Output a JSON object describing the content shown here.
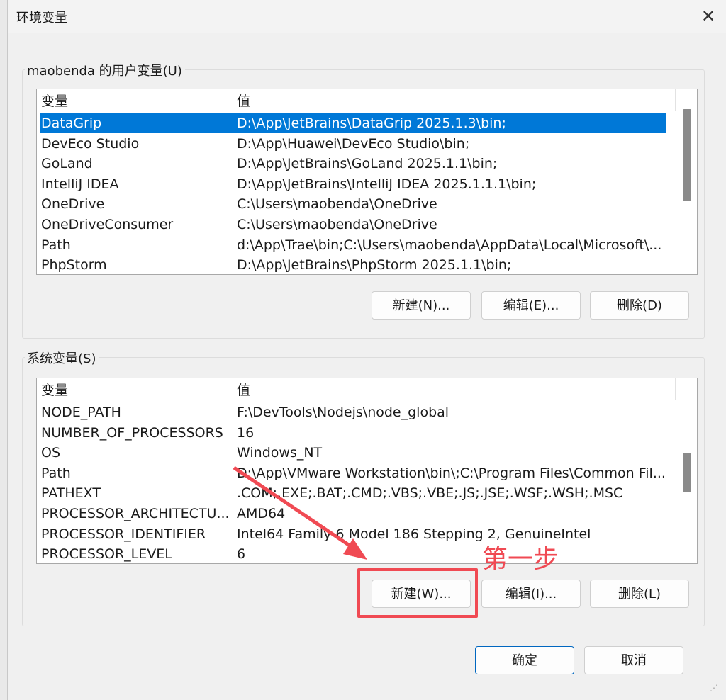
{
  "window": {
    "title": "环境变量",
    "close_glyph": "✕"
  },
  "user_vars": {
    "label": "maobenda 的用户变量(U)",
    "headers": {
      "name": "变量",
      "value": "值"
    },
    "rows": [
      {
        "name": "DataGrip",
        "value": "D:\\App\\JetBrains\\DataGrip 2025.1.3\\bin;"
      },
      {
        "name": "DevEco Studio",
        "value": "D:\\App\\Huawei\\DevEco Studio\\bin;"
      },
      {
        "name": "GoLand",
        "value": "D:\\App\\JetBrains\\GoLand 2025.1.1\\bin;"
      },
      {
        "name": "IntelliJ IDEA",
        "value": "D:\\App\\JetBrains\\IntelliJ IDEA 2025.1.1.1\\bin;"
      },
      {
        "name": "OneDrive",
        "value": "C:\\Users\\maobenda\\OneDrive"
      },
      {
        "name": "OneDriveConsumer",
        "value": "C:\\Users\\maobenda\\OneDrive"
      },
      {
        "name": "Path",
        "value": "d:\\App\\Trae\\bin;C:\\Users\\maobenda\\AppData\\Local\\Microsoft\\..."
      },
      {
        "name": "PhpStorm",
        "value": "D:\\App\\JetBrains\\PhpStorm 2025.1.1\\bin;"
      }
    ],
    "selected_row": "DataGrip",
    "buttons": {
      "new": "新建(N)...",
      "edit": "编辑(E)...",
      "delete": "删除(D)"
    }
  },
  "system_vars": {
    "label": "系统变量(S)",
    "headers": {
      "name": "变量",
      "value": "值"
    },
    "rows": [
      {
        "name": "NODE_PATH",
        "value": "F:\\DevTools\\Nodejs\\node_global"
      },
      {
        "name": "NUMBER_OF_PROCESSORS",
        "value": "16"
      },
      {
        "name": "OS",
        "value": "Windows_NT"
      },
      {
        "name": "Path",
        "value": "D:\\App\\VMware Workstation\\bin\\;C:\\Program Files\\Common Fil..."
      },
      {
        "name": "PATHEXT",
        "value": ".COM;.EXE;.BAT;.CMD;.VBS;.VBE;.JS;.JSE;.WSF;.WSH;.MSC"
      },
      {
        "name": "PROCESSOR_ARCHITECTU...",
        "value": "AMD64"
      },
      {
        "name": "PROCESSOR_IDENTIFIER",
        "value": "Intel64 Family 6 Model 186 Stepping 2, GenuineIntel"
      },
      {
        "name": "PROCESSOR_LEVEL",
        "value": "6"
      }
    ],
    "buttons": {
      "new": "新建(W)...",
      "edit": "编辑(I)...",
      "delete": "删除(L)"
    }
  },
  "footer": {
    "ok": "确定",
    "cancel": "取消"
  },
  "annotation": {
    "text": "第一步",
    "color": "#f04a53"
  },
  "colors": {
    "selection": "#0078d7",
    "primary_border": "#0067c0"
  }
}
